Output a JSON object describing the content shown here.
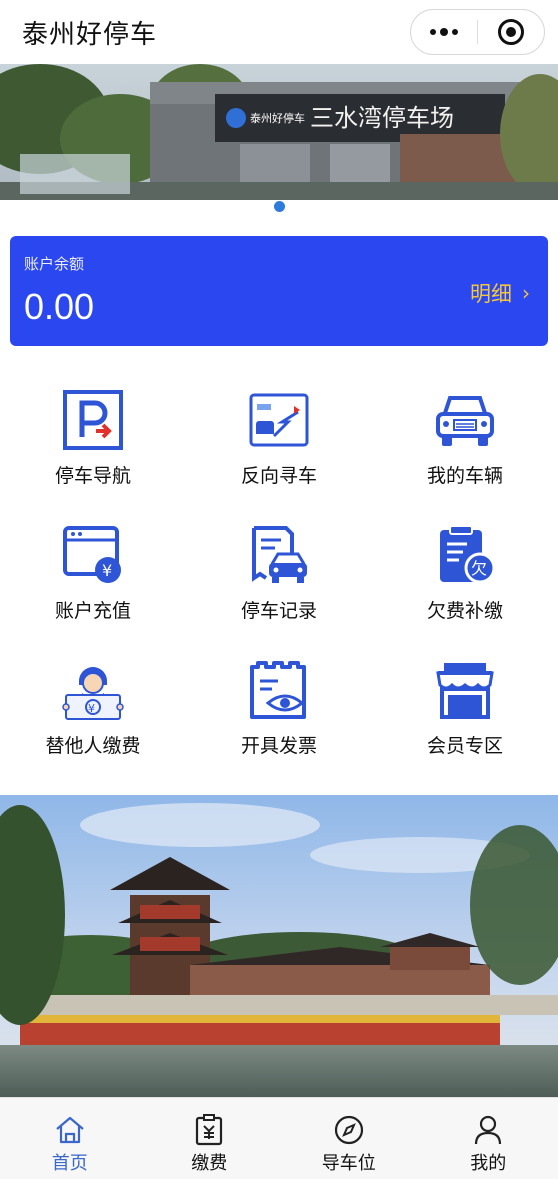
{
  "app": {
    "title": "泰州好停车"
  },
  "banner": {
    "sign_text": "三水湾停车场",
    "logo_text": "泰州好停车",
    "slide_count": 1,
    "active_slide": 1
  },
  "account": {
    "label": "账户余额",
    "balance": "0.00",
    "detail_label": "明细",
    "detail_chevron": "›"
  },
  "services": [
    {
      "label": "停车导航",
      "icon": "parking-navigation-icon"
    },
    {
      "label": "反向寻车",
      "icon": "reverse-find-car-icon"
    },
    {
      "label": "我的车辆",
      "icon": "my-vehicle-icon"
    },
    {
      "label": "账户充值",
      "icon": "account-recharge-icon"
    },
    {
      "label": "停车记录",
      "icon": "parking-record-icon"
    },
    {
      "label": "欠费补缴",
      "icon": "arrears-payment-icon"
    },
    {
      "label": "替他人缴费",
      "icon": "pay-for-others-icon"
    },
    {
      "label": "开具发票",
      "icon": "invoice-icon"
    },
    {
      "label": "会员专区",
      "icon": "member-area-icon"
    }
  ],
  "tabs": [
    {
      "label": "首页",
      "icon": "home-icon",
      "active": true
    },
    {
      "label": "缴费",
      "icon": "payment-icon",
      "active": false
    },
    {
      "label": "导车位",
      "icon": "compass-icon",
      "active": false
    },
    {
      "label": "我的",
      "icon": "user-icon",
      "active": false
    }
  ],
  "colors": {
    "primary": "#2a47f0",
    "accent": "#f3c63d",
    "icon_blue": "#2d55d6",
    "tab_active": "#3a67c9"
  }
}
